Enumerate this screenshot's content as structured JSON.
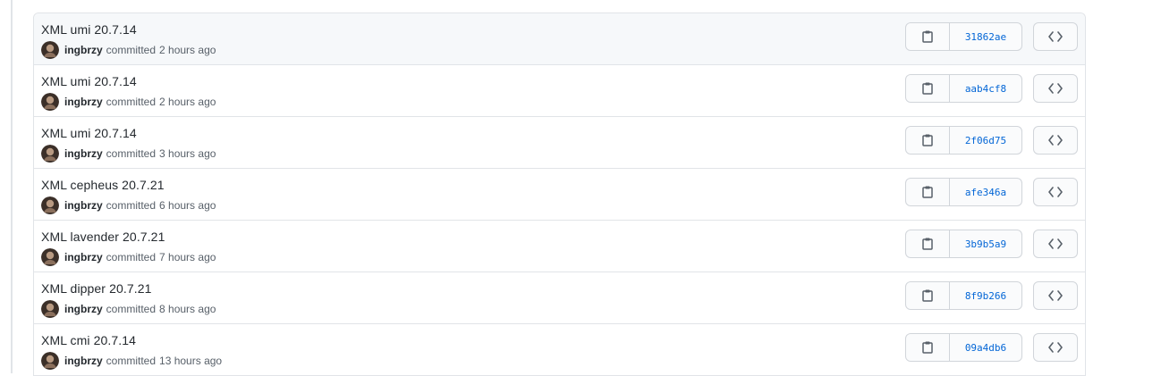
{
  "commits": [
    {
      "title": "XML umi 20.7.14",
      "author": "ingbrzy",
      "verb": "committed",
      "time": "2 hours ago",
      "sha": "31862ae"
    },
    {
      "title": "XML umi 20.7.14",
      "author": "ingbrzy",
      "verb": "committed",
      "time": "2 hours ago",
      "sha": "aab4cf8"
    },
    {
      "title": "XML umi 20.7.14",
      "author": "ingbrzy",
      "verb": "committed",
      "time": "3 hours ago",
      "sha": "2f06d75"
    },
    {
      "title": "XML cepheus 20.7.21",
      "author": "ingbrzy",
      "verb": "committed",
      "time": "6 hours ago",
      "sha": "afe346a"
    },
    {
      "title": "XML lavender 20.7.21",
      "author": "ingbrzy",
      "verb": "committed",
      "time": "7 hours ago",
      "sha": "3b9b5a9"
    },
    {
      "title": "XML dipper 20.7.21",
      "author": "ingbrzy",
      "verb": "committed",
      "time": "8 hours ago",
      "sha": "8f9b266"
    },
    {
      "title": "XML cmi 20.7.14",
      "author": "ingbrzy",
      "verb": "committed",
      "time": "13 hours ago",
      "sha": "09a4db6"
    }
  ],
  "icons": {
    "copy": "clippy-icon",
    "browse": "code-icon",
    "avatar": "user-avatar"
  },
  "colors": {
    "sha_link": "#0366d6",
    "border": "#e1e4e8",
    "first_row_bg": "#f6f8fa"
  }
}
